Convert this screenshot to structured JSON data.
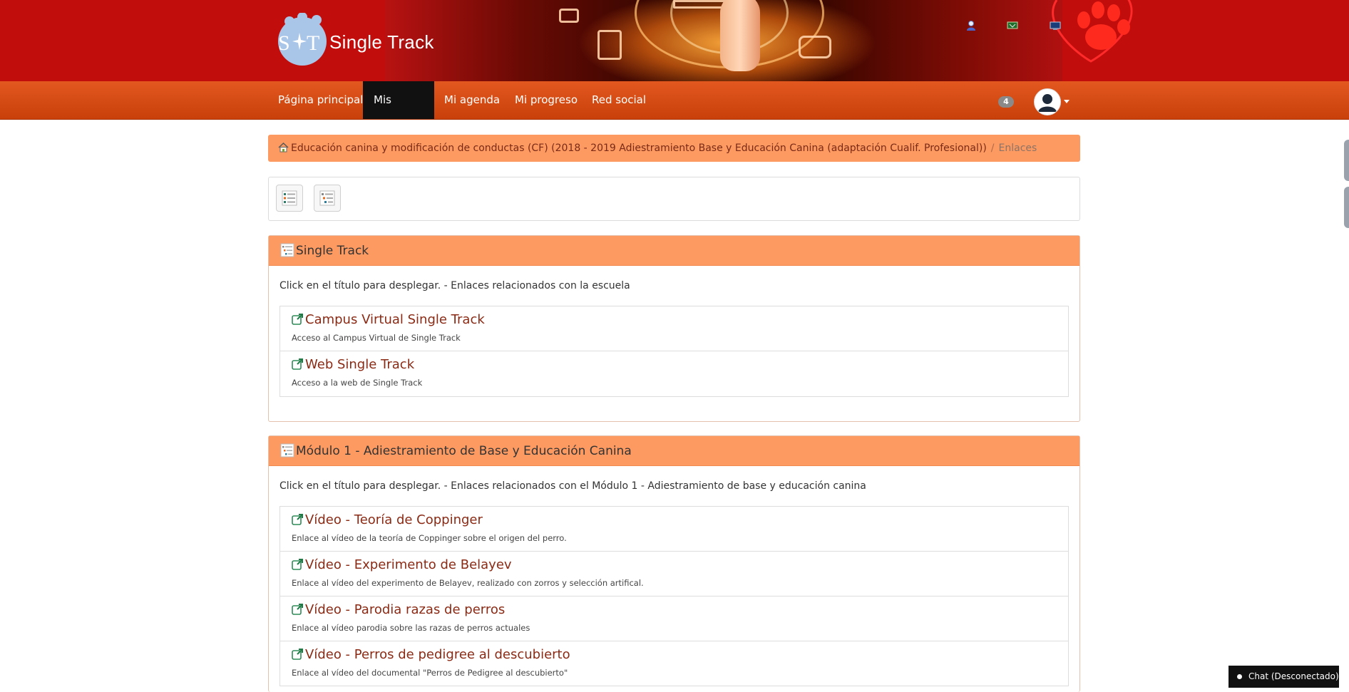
{
  "header": {
    "logo_text": "Single Track",
    "logo_initials": "S T"
  },
  "nav": {
    "items": [
      {
        "label": "Página principal"
      },
      {
        "label": "Mis cursos"
      },
      {
        "label": "Mi agenda"
      },
      {
        "label": "Mi progreso"
      },
      {
        "label": "Red social"
      }
    ],
    "notification_count": "4"
  },
  "breadcrumb": {
    "course": "Educación canina y modificación de conductas (CF) (2018 - 2019 Adiestramiento Base y Educación Canina (adaptación Cualif. Profesional))",
    "separator": "/",
    "current": "Enlaces"
  },
  "categories": [
    {
      "title": "Single Track",
      "description": "Click en el título para desplegar. - Enlaces relacionados con la escuela",
      "links": [
        {
          "title": "Campus Virtual Single Track",
          "description": "Acceso al Campus Virtual de Single Track"
        },
        {
          "title": "Web Single Track",
          "description": "Acceso a la web de Single Track"
        }
      ]
    },
    {
      "title": "Módulo 1 - Adiestramiento de Base y Educación Canina",
      "description": "Click en el título para desplegar. - Enlaces relacionados con el Módulo 1 - Adiestramiento de base y educación canina",
      "links": [
        {
          "title": "Vídeo - Teoría de Coppinger",
          "description": "Enlace al vídeo de la teoría de Coppinger sobre el origen del perro."
        },
        {
          "title": "Vídeo - Experimento de Belayev",
          "description": "Enlace al vídeo del experimento de Belayev, realizado con zorros y selección artifical."
        },
        {
          "title": "Vídeo - Parodia razas de perros",
          "description": "Enlace al vídeo parodia sobre las razas de perros actuales"
        },
        {
          "title": "Vídeo - Perros de pedigree al descubierto",
          "description": "Enlace al vídeo del documental \"Perros de Pedigree al descubierto\""
        }
      ]
    }
  ],
  "chat": {
    "label": "Chat (Desconectado)"
  },
  "colors": {
    "header_red": "#c20d0d",
    "nav_orange": "#d9480f",
    "panel_orange": "#fd9a62",
    "link_color": "#8b2a14"
  }
}
